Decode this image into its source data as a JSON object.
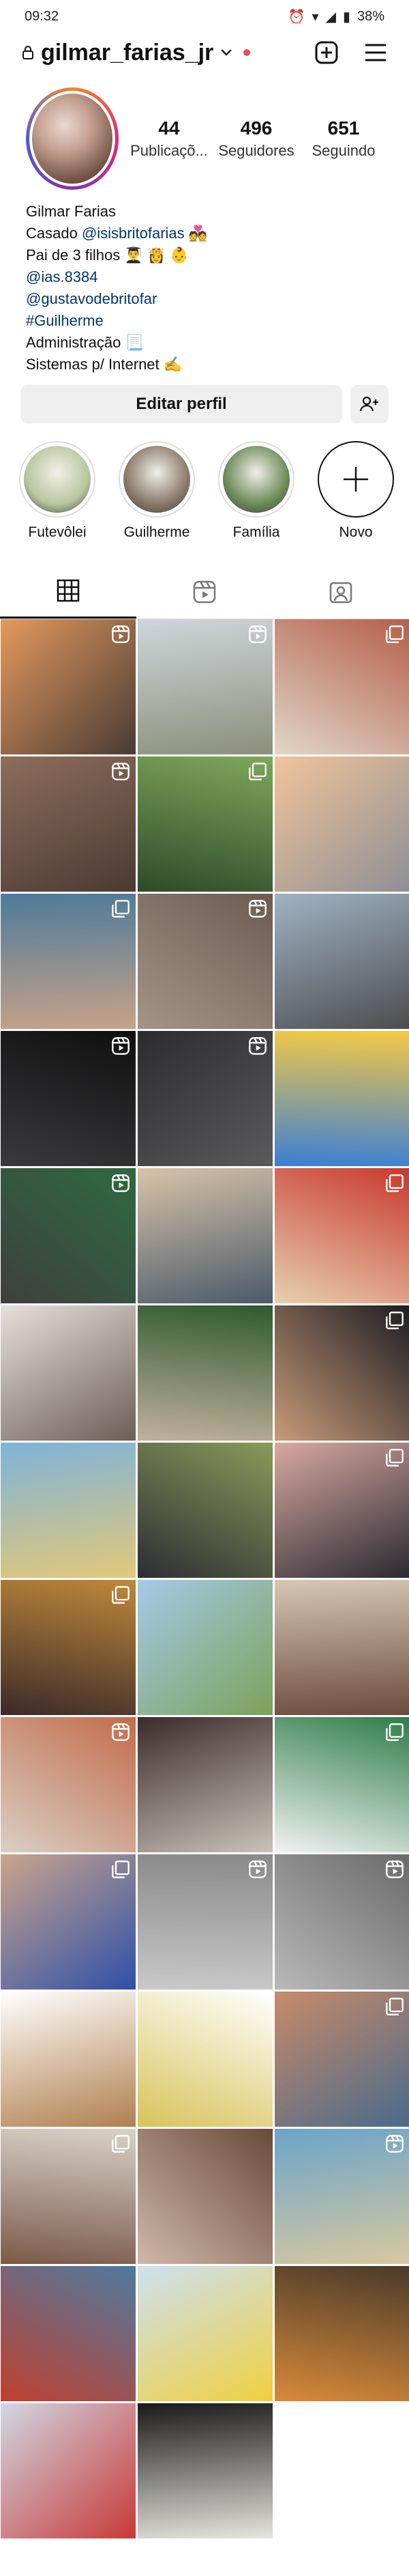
{
  "status_bar": {
    "time": "09:32",
    "battery": "38%"
  },
  "header": {
    "username": "gilmar_farias_jr"
  },
  "stats": [
    {
      "count": "44",
      "label": "Publicaçõ..."
    },
    {
      "count": "496",
      "label": "Seguidores"
    },
    {
      "count": "651",
      "label": "Seguindo"
    }
  ],
  "bio": {
    "name": "Gilmar Farias",
    "line1_prefix": "Casado ",
    "line1_link": "@isisbritofarias",
    "line1_suffix": " 💑",
    "line2": "Pai de 3 filhos 👨‍🎓 👸 👶",
    "link1": "@ias.8384",
    "link2": "@gustavodebritofar",
    "link3": "#Guilherme",
    "line6": "Administração 📃",
    "line7": "Sistemas p/ Internet ✍"
  },
  "actions": {
    "edit_profile": "Editar perfil"
  },
  "highlights": [
    {
      "label": "Futevôlei",
      "color": "#b9c7a0"
    },
    {
      "label": "Guilherme",
      "color": "#8a7a6a"
    },
    {
      "label": "Família",
      "color": "#6d8c5a"
    },
    {
      "label": "Novo"
    }
  ],
  "grid": [
    {
      "c1": "#e39a5d",
      "c2": "#4a3a35",
      "badge": "reel"
    },
    {
      "c1": "#cfd6dc",
      "c2": "#8c8f7a",
      "badge": "reel"
    },
    {
      "c1": "#b55f4a",
      "c2": "#e1d6c8",
      "badge": "multi"
    },
    {
      "c1": "#8d6d5c",
      "c2": "#4b3a33",
      "badge": "reel"
    },
    {
      "c1": "#7ea85b",
      "c2": "#2e4a2a",
      "badge": "multi"
    },
    {
      "c1": "#f0c49a",
      "c2": "#8f8f96",
      "badge": ""
    },
    {
      "c1": "#4e7a9a",
      "c2": "#c7a28a",
      "badge": "multi"
    },
    {
      "c1": "#6b5b52",
      "c2": "#a59485",
      "badge": "reel"
    },
    {
      "c1": "#9fb3c4",
      "c2": "#4d4d4f",
      "badge": ""
    },
    {
      "c1": "#0f0f10",
      "c2": "#3a3a3c",
      "badge": "reel"
    },
    {
      "c1": "#2c2c2e",
      "c2": "#5a5a5c",
      "badge": "reel"
    },
    {
      "c1": "#f4c945",
      "c2": "#3b7fd4",
      "badge": ""
    },
    {
      "c1": "#2f6a3f",
      "c2": "#3f3f3f",
      "badge": "reel"
    },
    {
      "c1": "#d9c3a8",
      "c2": "#4a5a6a",
      "badge": ""
    },
    {
      "c1": "#c9382c",
      "c2": "#e7d0b0",
      "badge": "multi"
    },
    {
      "c1": "#e6e1da",
      "c2": "#6d5d57",
      "badge": ""
    },
    {
      "c1": "#2f5a2e",
      "c2": "#c2b19a",
      "badge": ""
    },
    {
      "c1": "#1e1d22",
      "c2": "#c79b7a",
      "badge": "multi"
    },
    {
      "c1": "#7fb3d9",
      "c2": "#e1c87a",
      "badge": ""
    },
    {
      "c1": "#8a9a5a",
      "c2": "#2d2d33",
      "badge": ""
    },
    {
      "c1": "#d8a9a0",
      "c2": "#2b2a33",
      "badge": "multi"
    },
    {
      "c1": "#c0883a",
      "c2": "#3b2a2a",
      "badge": "multi"
    },
    {
      "c1": "#a6c9e8",
      "c2": "#7ba25b",
      "badge": ""
    },
    {
      "c1": "#d6c7b4",
      "c2": "#6d4b3e",
      "badge": ""
    },
    {
      "c1": "#c36b4a",
      "c2": "#d9cfc5",
      "badge": "reel"
    },
    {
      "c1": "#3b2b2b",
      "c2": "#cac2b8",
      "badge": ""
    },
    {
      "c1": "#2e7d4a",
      "c2": "#f2f2f2",
      "badge": "multi"
    },
    {
      "c1": "#caa58d",
      "c2": "#2f4fa8",
      "badge": "multi"
    },
    {
      "c1": "#8a8a8a",
      "c2": "#c8c8c8",
      "badge": "reel"
    },
    {
      "c1": "#6a6a6a",
      "c2": "#b9b9b9",
      "badge": "reel"
    },
    {
      "c1": "#ffffff",
      "c2": "#b08050",
      "badge": ""
    },
    {
      "c1": "#ffffff",
      "c2": "#d7c35a",
      "badge": ""
    },
    {
      "c1": "#c88a6a",
      "c2": "#4a6a8a",
      "badge": "multi"
    },
    {
      "c1": "#d9d2c9",
      "c2": "#7a5a4a",
      "badge": "multi"
    },
    {
      "c1": "#6a4a3a",
      "c2": "#d0b8a8",
      "badge": ""
    },
    {
      "c1": "#6aa4c9",
      "c2": "#d8c8a0",
      "badge": "reel"
    },
    {
      "c1": "#4e7aa0",
      "c2": "#c04030",
      "badge": ""
    },
    {
      "c1": "#cde0f0",
      "c2": "#f0d040",
      "badge": ""
    },
    {
      "c1": "#4a3a2a",
      "c2": "#d88a3a",
      "badge": ""
    },
    {
      "c1": "#d0d8e4",
      "c2": "#c83838",
      "badge": ""
    },
    {
      "c1": "#1a1a1a",
      "c2": "#e8e4df",
      "badge": ""
    }
  ]
}
